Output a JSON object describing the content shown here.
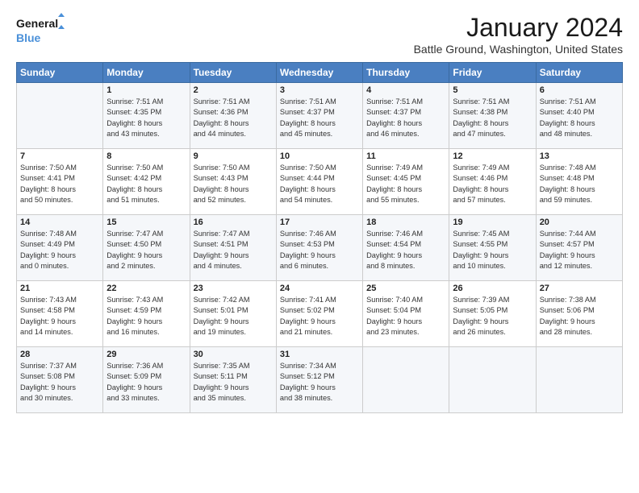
{
  "header": {
    "logo_line1": "General",
    "logo_line2": "Blue",
    "month_title": "January 2024",
    "location": "Battle Ground, Washington, United States"
  },
  "weekdays": [
    "Sunday",
    "Monday",
    "Tuesday",
    "Wednesday",
    "Thursday",
    "Friday",
    "Saturday"
  ],
  "weeks": [
    [
      {
        "num": "",
        "info": ""
      },
      {
        "num": "1",
        "info": "Sunrise: 7:51 AM\nSunset: 4:35 PM\nDaylight: 8 hours\nand 43 minutes."
      },
      {
        "num": "2",
        "info": "Sunrise: 7:51 AM\nSunset: 4:36 PM\nDaylight: 8 hours\nand 44 minutes."
      },
      {
        "num": "3",
        "info": "Sunrise: 7:51 AM\nSunset: 4:37 PM\nDaylight: 8 hours\nand 45 minutes."
      },
      {
        "num": "4",
        "info": "Sunrise: 7:51 AM\nSunset: 4:37 PM\nDaylight: 8 hours\nand 46 minutes."
      },
      {
        "num": "5",
        "info": "Sunrise: 7:51 AM\nSunset: 4:38 PM\nDaylight: 8 hours\nand 47 minutes."
      },
      {
        "num": "6",
        "info": "Sunrise: 7:51 AM\nSunset: 4:40 PM\nDaylight: 8 hours\nand 48 minutes."
      }
    ],
    [
      {
        "num": "7",
        "info": "Sunrise: 7:50 AM\nSunset: 4:41 PM\nDaylight: 8 hours\nand 50 minutes."
      },
      {
        "num": "8",
        "info": "Sunrise: 7:50 AM\nSunset: 4:42 PM\nDaylight: 8 hours\nand 51 minutes."
      },
      {
        "num": "9",
        "info": "Sunrise: 7:50 AM\nSunset: 4:43 PM\nDaylight: 8 hours\nand 52 minutes."
      },
      {
        "num": "10",
        "info": "Sunrise: 7:50 AM\nSunset: 4:44 PM\nDaylight: 8 hours\nand 54 minutes."
      },
      {
        "num": "11",
        "info": "Sunrise: 7:49 AM\nSunset: 4:45 PM\nDaylight: 8 hours\nand 55 minutes."
      },
      {
        "num": "12",
        "info": "Sunrise: 7:49 AM\nSunset: 4:46 PM\nDaylight: 8 hours\nand 57 minutes."
      },
      {
        "num": "13",
        "info": "Sunrise: 7:48 AM\nSunset: 4:48 PM\nDaylight: 8 hours\nand 59 minutes."
      }
    ],
    [
      {
        "num": "14",
        "info": "Sunrise: 7:48 AM\nSunset: 4:49 PM\nDaylight: 9 hours\nand 0 minutes."
      },
      {
        "num": "15",
        "info": "Sunrise: 7:47 AM\nSunset: 4:50 PM\nDaylight: 9 hours\nand 2 minutes."
      },
      {
        "num": "16",
        "info": "Sunrise: 7:47 AM\nSunset: 4:51 PM\nDaylight: 9 hours\nand 4 minutes."
      },
      {
        "num": "17",
        "info": "Sunrise: 7:46 AM\nSunset: 4:53 PM\nDaylight: 9 hours\nand 6 minutes."
      },
      {
        "num": "18",
        "info": "Sunrise: 7:46 AM\nSunset: 4:54 PM\nDaylight: 9 hours\nand 8 minutes."
      },
      {
        "num": "19",
        "info": "Sunrise: 7:45 AM\nSunset: 4:55 PM\nDaylight: 9 hours\nand 10 minutes."
      },
      {
        "num": "20",
        "info": "Sunrise: 7:44 AM\nSunset: 4:57 PM\nDaylight: 9 hours\nand 12 minutes."
      }
    ],
    [
      {
        "num": "21",
        "info": "Sunrise: 7:43 AM\nSunset: 4:58 PM\nDaylight: 9 hours\nand 14 minutes."
      },
      {
        "num": "22",
        "info": "Sunrise: 7:43 AM\nSunset: 4:59 PM\nDaylight: 9 hours\nand 16 minutes."
      },
      {
        "num": "23",
        "info": "Sunrise: 7:42 AM\nSunset: 5:01 PM\nDaylight: 9 hours\nand 19 minutes."
      },
      {
        "num": "24",
        "info": "Sunrise: 7:41 AM\nSunset: 5:02 PM\nDaylight: 9 hours\nand 21 minutes."
      },
      {
        "num": "25",
        "info": "Sunrise: 7:40 AM\nSunset: 5:04 PM\nDaylight: 9 hours\nand 23 minutes."
      },
      {
        "num": "26",
        "info": "Sunrise: 7:39 AM\nSunset: 5:05 PM\nDaylight: 9 hours\nand 26 minutes."
      },
      {
        "num": "27",
        "info": "Sunrise: 7:38 AM\nSunset: 5:06 PM\nDaylight: 9 hours\nand 28 minutes."
      }
    ],
    [
      {
        "num": "28",
        "info": "Sunrise: 7:37 AM\nSunset: 5:08 PM\nDaylight: 9 hours\nand 30 minutes."
      },
      {
        "num": "29",
        "info": "Sunrise: 7:36 AM\nSunset: 5:09 PM\nDaylight: 9 hours\nand 33 minutes."
      },
      {
        "num": "30",
        "info": "Sunrise: 7:35 AM\nSunset: 5:11 PM\nDaylight: 9 hours\nand 35 minutes."
      },
      {
        "num": "31",
        "info": "Sunrise: 7:34 AM\nSunset: 5:12 PM\nDaylight: 9 hours\nand 38 minutes."
      },
      {
        "num": "",
        "info": ""
      },
      {
        "num": "",
        "info": ""
      },
      {
        "num": "",
        "info": ""
      }
    ]
  ]
}
